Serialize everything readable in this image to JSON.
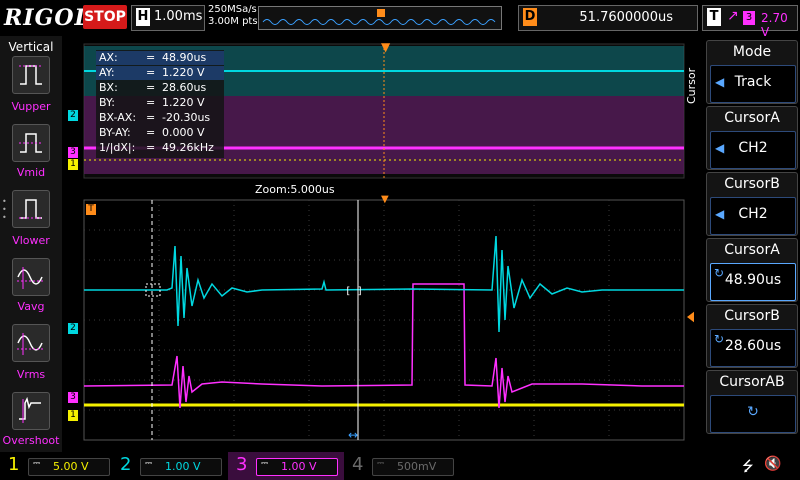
{
  "topbar": {
    "logo": "RIGOL",
    "run_state": "STOP",
    "h_label": "H",
    "timebase": "1.00ms",
    "sample_rate": "250MSa/s",
    "memory_depth": "3.00M pts",
    "delay_label": "D",
    "delay_value": "51.7600000us",
    "trigger_label": "T",
    "trigger_edge": "↗",
    "trigger_source": "3",
    "trigger_level": "2.70 V"
  },
  "left_panel": {
    "title": "Vertical",
    "items": [
      {
        "label": "Vupper",
        "icon": "vupper-icon"
      },
      {
        "label": "Vmid",
        "icon": "vmid-icon"
      },
      {
        "label": "Vlower",
        "icon": "vlower-icon"
      },
      {
        "label": "Vavg",
        "icon": "vavg-icon"
      },
      {
        "label": "Vrms",
        "icon": "vrms-icon"
      },
      {
        "label": "Overshoot",
        "icon": "overshoot-icon"
      }
    ]
  },
  "cursor_table": {
    "rows": [
      {
        "key": "AX:",
        "eq": "=",
        "value": "48.90us",
        "selected": true
      },
      {
        "key": "AY:",
        "eq": "=",
        "value": "1.220 V",
        "selected": true
      },
      {
        "key": "BX:",
        "eq": "=",
        "value": "28.60us",
        "selected": false
      },
      {
        "key": "BY:",
        "eq": "=",
        "value": "1.220 V",
        "selected": false
      },
      {
        "key": "BX-AX:",
        "eq": "=",
        "value": "-20.30us",
        "selected": false
      },
      {
        "key": "BY-AY:",
        "eq": "=",
        "value": "0.000 V",
        "selected": false
      },
      {
        "key": "1/|dX|:",
        "eq": "=",
        "value": "49.26kHz",
        "selected": false
      }
    ]
  },
  "zoom_label": "Zoom:5.000us",
  "channel_markers": {
    "ch1": "1",
    "ch2": "2",
    "ch3": "3",
    "trig": "T"
  },
  "right_panel": {
    "side_label": "Cursor",
    "boxes": [
      {
        "title": "Mode",
        "value": "Track",
        "kind": "arrow"
      },
      {
        "title": "CursorA",
        "value": "CH2",
        "kind": "arrow"
      },
      {
        "title": "CursorB",
        "value": "CH2",
        "kind": "arrow"
      },
      {
        "title": "CursorA",
        "value": "48.90us",
        "kind": "knob"
      },
      {
        "title": "CursorB",
        "value": "28.60us",
        "kind": "knob"
      },
      {
        "title": "CursorAB",
        "value": "",
        "kind": "knob-only"
      }
    ]
  },
  "bottombar": {
    "channels": [
      {
        "num": "1",
        "scale": "5.00 V",
        "color": "#f5f000",
        "active": true
      },
      {
        "num": "2",
        "scale": "1.00 V",
        "color": "#00d8e0",
        "active": true
      },
      {
        "num": "3",
        "scale": "1.00 V",
        "color": "#ff30ff",
        "active": true
      },
      {
        "num": "4",
        "scale": "500mV",
        "color": "#6a6a6a",
        "active": false
      }
    ]
  },
  "colors": {
    "ch1": "#f5f000",
    "ch2": "#00d8e0",
    "ch3": "#ff30ff",
    "accent": "#ff8c1a",
    "grid": "#3a3a3a",
    "highlight": "#5aa8ff"
  }
}
